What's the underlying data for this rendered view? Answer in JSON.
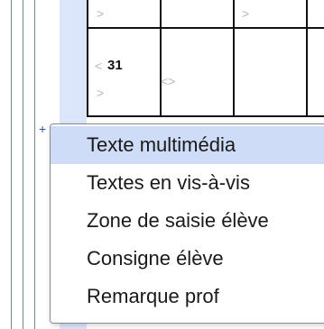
{
  "grid": {
    "day_number": "31",
    "chevron_glyph": ">",
    "chevron_left_glyph": "<",
    "diamond_glyph": "<>"
  },
  "add_marker_glyph": "+",
  "context_menu": {
    "items": [
      {
        "label": "Texte multimédia",
        "highlighted": true
      },
      {
        "label": "Textes en vis-à-vis",
        "highlighted": false
      },
      {
        "label": "Zone de saisie élève",
        "highlighted": false
      },
      {
        "label": "Consigne élève",
        "highlighted": false
      },
      {
        "label": "Remarque prof",
        "highlighted": false
      }
    ]
  },
  "colors": {
    "menu_highlight": "#cfdcf7",
    "margin_strip": "#dce6fb",
    "grid_lines": "#111111"
  }
}
